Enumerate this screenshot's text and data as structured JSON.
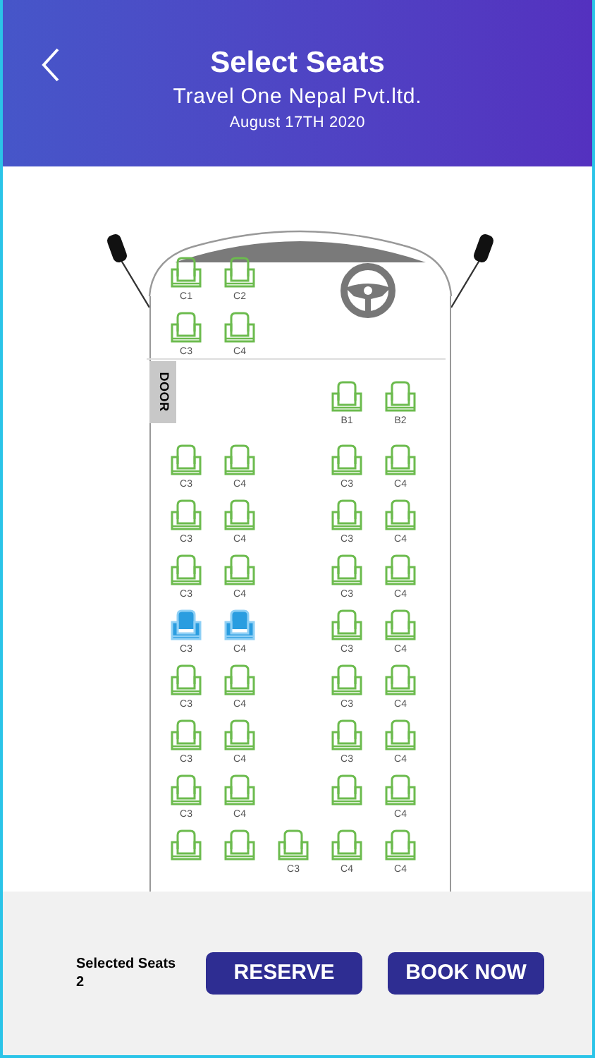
{
  "header": {
    "title": "Select Seats",
    "operator": "Travel One Nepal Pvt.ltd.",
    "date": "August 17TH 2020"
  },
  "door": "DOOR",
  "rows": [
    {
      "seats": [
        {
          "kind": "seat",
          "label": "C1",
          "selected": false
        },
        {
          "kind": "seat",
          "label": "C2",
          "selected": false
        },
        {
          "kind": "empty"
        },
        {
          "kind": "wheel"
        },
        {
          "kind": "empty"
        }
      ]
    },
    {
      "seats": [
        {
          "kind": "seat",
          "label": "C3",
          "selected": false
        },
        {
          "kind": "seat",
          "label": "C4",
          "selected": false
        },
        {
          "kind": "empty"
        },
        {
          "kind": "empty"
        },
        {
          "kind": "empty"
        }
      ]
    },
    {
      "seats": [
        {
          "kind": "empty"
        },
        {
          "kind": "empty"
        },
        {
          "kind": "empty"
        },
        {
          "kind": "seat",
          "label": "B1",
          "selected": false
        },
        {
          "kind": "seat",
          "label": "B2",
          "selected": false
        }
      ]
    },
    {
      "seats": [
        {
          "kind": "seat",
          "label": "C3",
          "selected": false
        },
        {
          "kind": "seat",
          "label": "C4",
          "selected": false
        },
        {
          "kind": "empty"
        },
        {
          "kind": "seat",
          "label": "C3",
          "selected": false
        },
        {
          "kind": "seat",
          "label": "C4",
          "selected": false
        }
      ]
    },
    {
      "seats": [
        {
          "kind": "seat",
          "label": "C3",
          "selected": false
        },
        {
          "kind": "seat",
          "label": "C4",
          "selected": false
        },
        {
          "kind": "empty"
        },
        {
          "kind": "seat",
          "label": "C3",
          "selected": false
        },
        {
          "kind": "seat",
          "label": "C4",
          "selected": false
        }
      ]
    },
    {
      "seats": [
        {
          "kind": "seat",
          "label": "C3",
          "selected": false
        },
        {
          "kind": "seat",
          "label": "C4",
          "selected": false
        },
        {
          "kind": "empty"
        },
        {
          "kind": "seat",
          "label": "C3",
          "selected": false
        },
        {
          "kind": "seat",
          "label": "C4",
          "selected": false
        }
      ]
    },
    {
      "seats": [
        {
          "kind": "seat",
          "label": "C3",
          "selected": true
        },
        {
          "kind": "seat",
          "label": "C4",
          "selected": true
        },
        {
          "kind": "empty"
        },
        {
          "kind": "seat",
          "label": "C3",
          "selected": false
        },
        {
          "kind": "seat",
          "label": "C4",
          "selected": false
        }
      ]
    },
    {
      "seats": [
        {
          "kind": "seat",
          "label": "C3",
          "selected": false
        },
        {
          "kind": "seat",
          "label": "C4",
          "selected": false
        },
        {
          "kind": "empty"
        },
        {
          "kind": "seat",
          "label": "C3",
          "selected": false
        },
        {
          "kind": "seat",
          "label": "C4",
          "selected": false
        }
      ]
    },
    {
      "seats": [
        {
          "kind": "seat",
          "label": "C3",
          "selected": false
        },
        {
          "kind": "seat",
          "label": "C4",
          "selected": false
        },
        {
          "kind": "empty"
        },
        {
          "kind": "seat",
          "label": "C3",
          "selected": false
        },
        {
          "kind": "seat",
          "label": "C4",
          "selected": false
        }
      ]
    },
    {
      "seats": [
        {
          "kind": "seat",
          "label": "C3",
          "selected": false
        },
        {
          "kind": "seat",
          "label": "C4",
          "selected": false
        },
        {
          "kind": "empty"
        },
        {
          "kind": "seat",
          "selected": false
        },
        {
          "kind": "seat",
          "label": "C4",
          "selected": false
        }
      ]
    },
    {
      "seats": [
        {
          "kind": "seat",
          "selected": false
        },
        {
          "kind": "seat",
          "selected": false
        },
        {
          "kind": "seat",
          "label": "C3",
          "selected": false
        },
        {
          "kind": "seat",
          "label": "C4",
          "selected": false
        },
        {
          "kind": "seat",
          "label": "C4",
          "selected": false
        }
      ]
    }
  ],
  "footer": {
    "selected_label": "Selected Seats",
    "selected_count": "2",
    "buttons": [
      "RESERVE",
      "BOOK NOW"
    ]
  }
}
